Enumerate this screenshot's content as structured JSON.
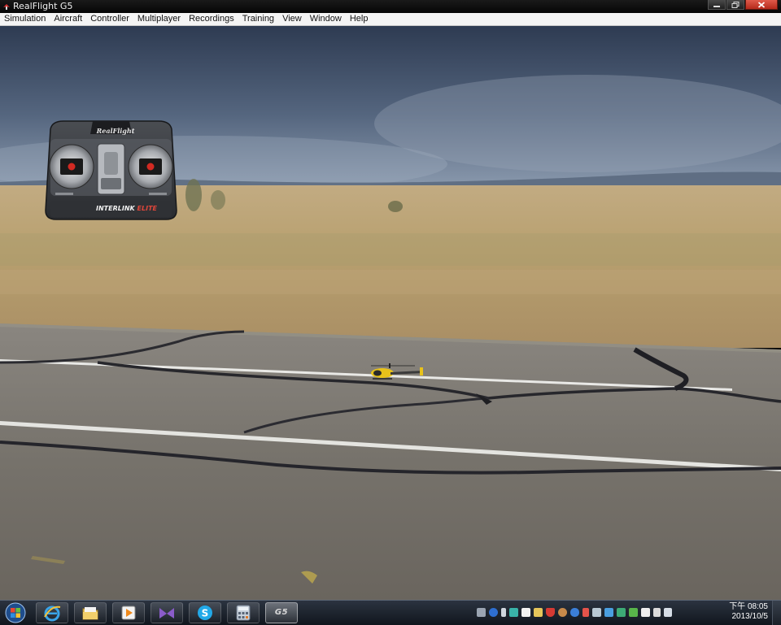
{
  "window": {
    "title": "RealFlight G5",
    "controls": [
      "minimize",
      "restore",
      "close"
    ]
  },
  "menu": {
    "items": [
      "Simulation",
      "Aircraft",
      "Controller",
      "Multiplayer",
      "Recordings",
      "Training",
      "View",
      "Window",
      "Help"
    ]
  },
  "controller_overlay": {
    "brand": "RealFlight",
    "model": "INTERLINK",
    "edition": "ELITE"
  },
  "scene": {
    "aircraft": "helicopter-icon",
    "colors": {
      "sky_top": "#2e3b52",
      "sky_bottom": "#8b9aae",
      "field": "#b79c6f",
      "runway": "#76726b",
      "helicopter_body": "#e8c21a"
    }
  },
  "taskbar": {
    "apps": [
      "internet-explorer-icon",
      "file-explorer-icon",
      "media-player-icon",
      "visual-studio-icon",
      "skype-icon",
      "calculator-icon",
      "realflight-g5-icon"
    ],
    "active_app_label": "G5",
    "tray_icons": [
      "keyboard-icon",
      "help-icon",
      "usb-icon",
      "network-icon",
      "note-icon",
      "monitor-icon",
      "shield-icon",
      "bug-icon",
      "bluetooth-icon",
      "arrow-icon",
      "chat-icon",
      "display-icon",
      "sync-icon",
      "leaf-icon",
      "flag-icon",
      "power-icon",
      "volume-icon"
    ],
    "clock": {
      "time": "下午 08:05",
      "date": "2013/10/5"
    }
  }
}
